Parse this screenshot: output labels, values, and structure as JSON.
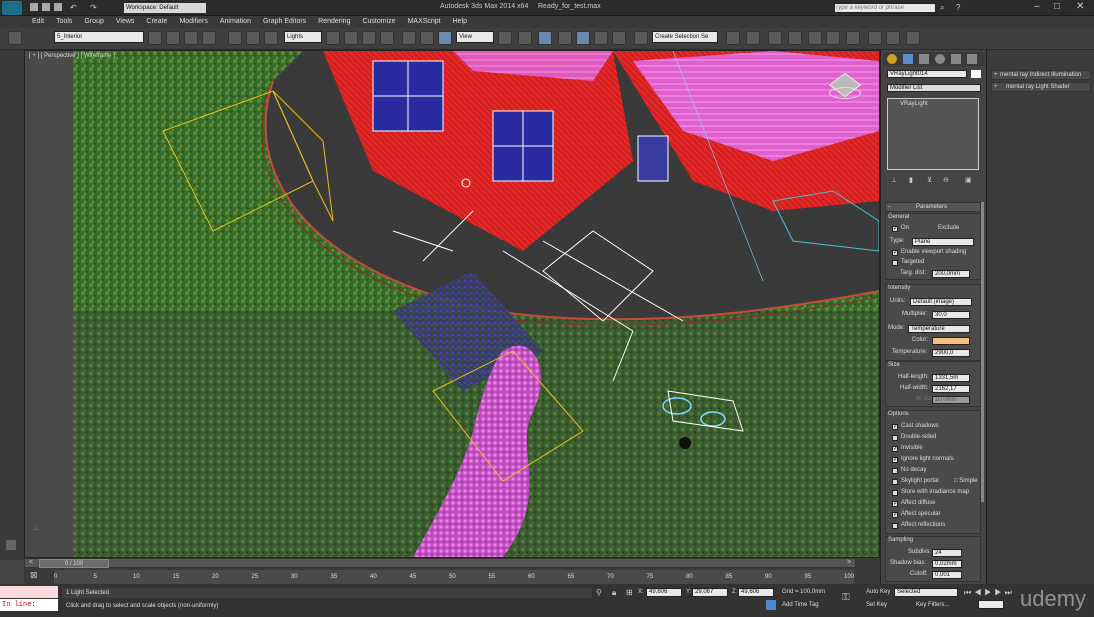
{
  "titlebar": {
    "workspace": "Workspace: Default",
    "app_title": "Autodesk 3ds Max 2014 x64",
    "file_name": "Ready_for_test.max",
    "search_placeholder": "Type a keyword or phrase"
  },
  "menu": {
    "items": [
      "Edit",
      "Tools",
      "Group",
      "Views",
      "Create",
      "Modifiers",
      "Animation",
      "Graph Editors",
      "Rendering",
      "Customize",
      "MAXScript",
      "Help"
    ]
  },
  "toolbar": {
    "layer": "5_Interior",
    "filter": "Lights",
    "ref_coord": "View",
    "selection_set": "Create Selection Se"
  },
  "viewport": {
    "label": "[ + ] [ Perspective ] [ Wireframe ]"
  },
  "command_panel": {
    "object_name": "VRayLight014",
    "modifier_list": "Modifier List",
    "stack_item": "VRayLight",
    "rollout_title": "Parameters",
    "general": {
      "title": "General",
      "on_label": "On",
      "exclude_label": "Exclude",
      "type_label": "Type:",
      "type_value": "Plane",
      "enable_viewport_shading": "Enable viewport shading",
      "targeted": "Targeted",
      "targ_dist_label": "Targ. dist:",
      "targ_dist_value": "200,0mm"
    },
    "intensity": {
      "title": "Intensity",
      "units_label": "Units:",
      "units_value": "Default (image)",
      "multiplier_label": "Multiplier:",
      "multiplier_value": "30,0",
      "mode_label": "Mode:",
      "mode_value": "Temperature",
      "color_label": "Color:",
      "temperature_label": "Temperature:",
      "temperature_value": "2900,0"
    },
    "size": {
      "title": "Size",
      "half_length_label": "Half-length:",
      "half_length_value": "1331,5m",
      "half_width_label": "Half-width:",
      "half_width_value": "2162,17",
      "w_size_label": "W size",
      "w_size_value": "10,0mm"
    },
    "options": {
      "title": "Options",
      "items": [
        {
          "label": "Cast shadows",
          "checked": true
        },
        {
          "label": "Double-sided",
          "checked": false
        },
        {
          "label": "Invisible",
          "checked": true
        },
        {
          "label": "Ignore light normals",
          "checked": true
        },
        {
          "label": "No decay",
          "checked": false
        },
        {
          "label": "Skylight portal",
          "checked": false
        },
        {
          "label": "Store with irradiance map",
          "checked": false
        },
        {
          "label": "Affect diffuse",
          "checked": true
        },
        {
          "label": "Affect specular",
          "checked": true
        },
        {
          "label": "Affect reflections",
          "checked": false
        }
      ],
      "simple_label": "Simple"
    },
    "sampling": {
      "title": "Sampling",
      "subdivs_label": "Subdivs:",
      "subdivs_value": "24",
      "shadow_bias_label": "Shadow bias:",
      "shadow_bias_value": "0,02mm",
      "cutoff_label": "Cutoff:",
      "cutoff_value": "0,001"
    }
  },
  "right_panel": {
    "items": [
      "mental ray Indirect Illumination",
      "mental ray Light Shader"
    ]
  },
  "timeline": {
    "frame_counter": "0 / 100",
    "ticks": [
      "0",
      "5",
      "10",
      "15",
      "20",
      "25",
      "30",
      "35",
      "40",
      "45",
      "50",
      "55",
      "60",
      "65",
      "70",
      "75",
      "80",
      "85",
      "90",
      "95",
      "100"
    ]
  },
  "status": {
    "mini_listener": "In line:",
    "selection_info": "1 Light Selected",
    "prompt": "Click and drag to select and scale objects (non-uniformly)",
    "x_label": "X:",
    "x_value": "49,606",
    "y_label": "Y:",
    "y_value": "29,067",
    "z_label": "Z:",
    "z_value": "49,606",
    "grid": "Grid = 100,0mm",
    "add_time_tag": "Add Time Tag",
    "auto_key": "Auto Key",
    "set_key": "Set Key",
    "key_mode": "Selected",
    "key_filters": "Key Filters..."
  },
  "colors": {
    "house_red": "#d42020",
    "roof_pink": "#e060d0",
    "grass_green": "#3a7a2a",
    "path_dark": "#3c3c3c",
    "light_color": "#f4c07a"
  }
}
